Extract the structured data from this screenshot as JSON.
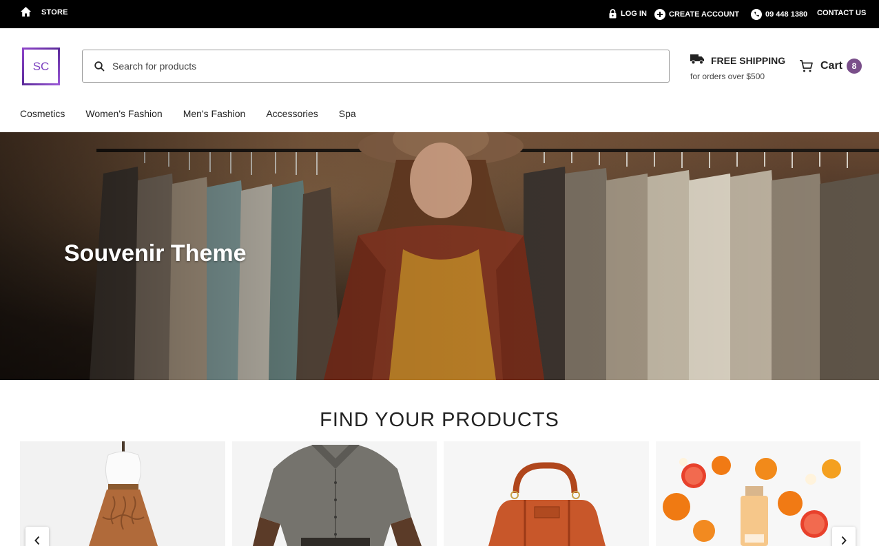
{
  "topbar": {
    "store_label": "STORE",
    "login_label": "LOG IN",
    "create_account_label": "CREATE ACCOUNT",
    "phone": "09 448 1380",
    "contact_label": "CONTACT US",
    "icons": [
      "home-icon",
      "lock-icon",
      "plus-circle-icon",
      "phone-icon"
    ]
  },
  "header": {
    "logo_text": "SC",
    "search": {
      "placeholder": "Search for products",
      "value": ""
    },
    "shipping": {
      "title": "FREE SHIPPING",
      "subtitle": "for orders over $500"
    },
    "cart": {
      "label": "Cart",
      "count": "8"
    }
  },
  "nav": {
    "items": [
      {
        "label": "Cosmetics"
      },
      {
        "label": "Women's Fashion"
      },
      {
        "label": "Men's Fashion"
      },
      {
        "label": "Accessories"
      },
      {
        "label": "Spa"
      }
    ]
  },
  "hero": {
    "title": "Souvenir Theme"
  },
  "products": {
    "section_title": "FIND YOUR PRODUCTS",
    "cards": [
      {
        "image": "mannequin-skirt-image"
      },
      {
        "image": "mens-shirt-image"
      },
      {
        "image": "leather-handbag-image"
      },
      {
        "image": "citrus-cosmetics-image"
      }
    ]
  },
  "colors": {
    "topbar_bg": "#000000",
    "badge": "#7a4f8a",
    "logo_purple": "#7b3fbf"
  }
}
